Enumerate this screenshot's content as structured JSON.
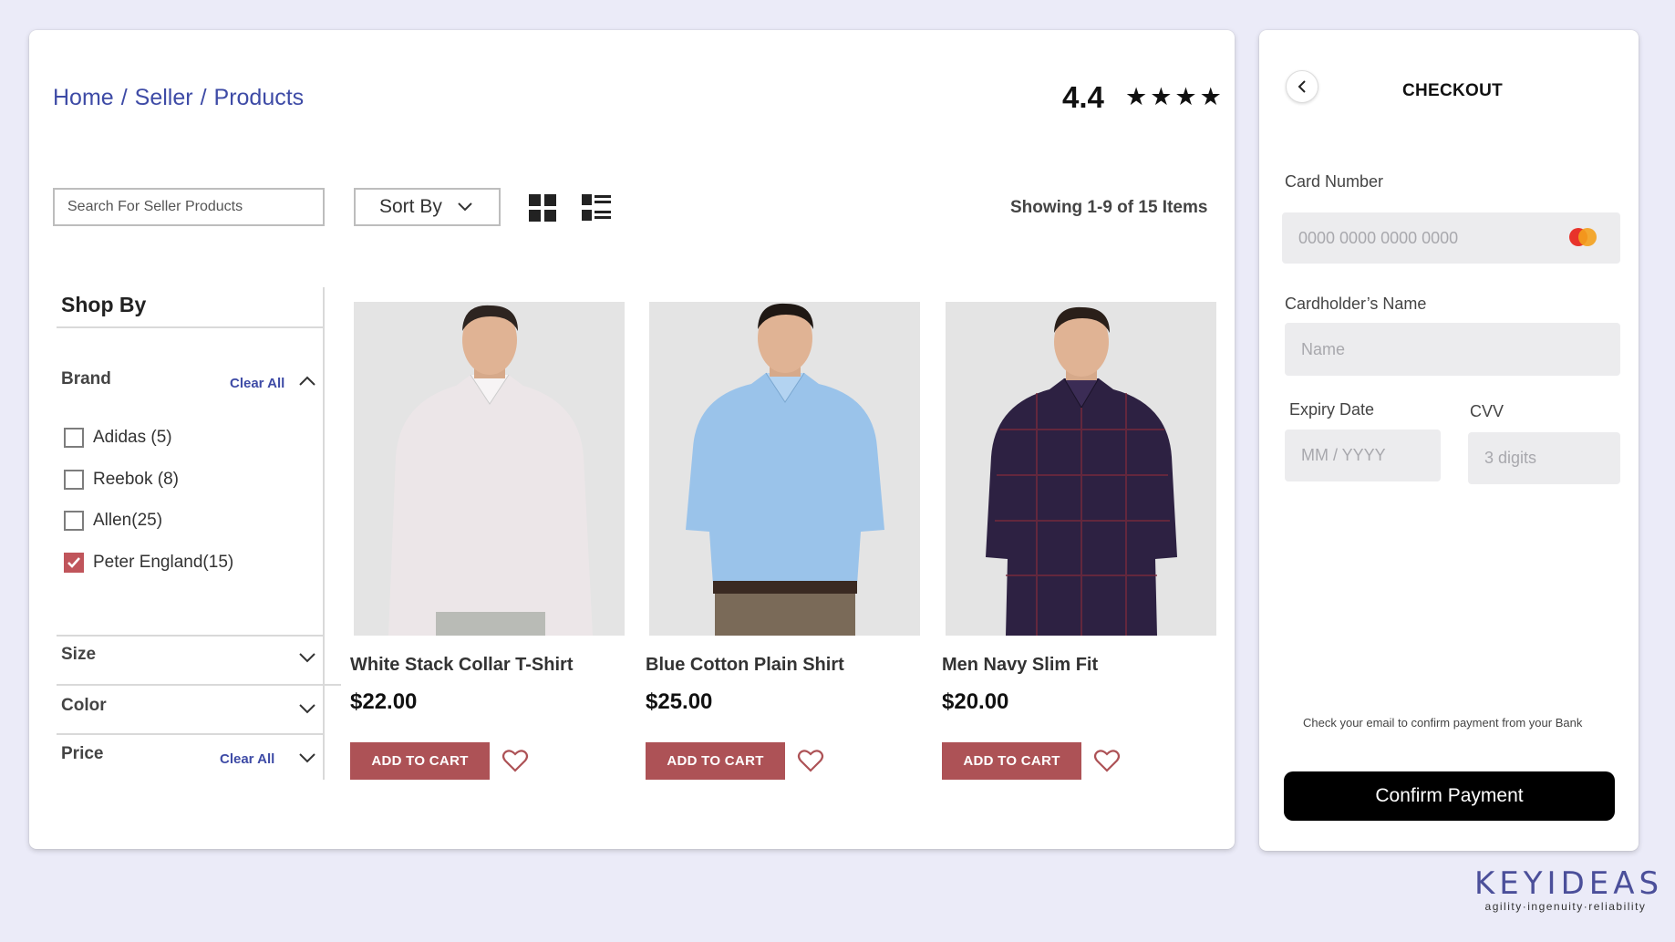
{
  "breadcrumb": {
    "items": [
      "Home",
      "Seller",
      "Products"
    ],
    "separator": "/"
  },
  "rating": {
    "value": "4.4",
    "stars": "★★★★"
  },
  "search": {
    "placeholder": "Search For Seller Products"
  },
  "sort": {
    "label": "Sort By"
  },
  "results": {
    "showing": "Showing 1-9 of 15 Items"
  },
  "sidebar": {
    "title": "Shop By",
    "brand": {
      "title": "Brand",
      "clear": "Clear All",
      "options": [
        {
          "label": "Adidas (5)",
          "checked": false
        },
        {
          "label": "Reebok (8)",
          "checked": false
        },
        {
          "label": "Allen(25)",
          "checked": false
        },
        {
          "label": "Peter England(15)",
          "checked": true
        }
      ]
    },
    "size": {
      "title": "Size"
    },
    "color": {
      "title": "Color"
    },
    "price": {
      "title": "Price",
      "clear": "Clear All"
    }
  },
  "products": [
    {
      "name": "White Stack Collar T-Shirt",
      "price": "$22.00",
      "cart_label": "ADD TO CART",
      "shirt_color": "#ece6e8"
    },
    {
      "name": "Blue Cotton Plain Shirt",
      "price": "$25.00",
      "cart_label": "ADD TO CART",
      "shirt_color": "#9ac3ea"
    },
    {
      "name": "Men Navy Slim Fit",
      "price": "$20.00",
      "cart_label": "ADD TO CART",
      "shirt_color": "#2d2142"
    }
  ],
  "checkout": {
    "title": "CHECKOUT",
    "card_number": {
      "label": "Card Number",
      "placeholder": "0000 0000 0000 0000"
    },
    "cardholder": {
      "label": "Cardholder’s Name",
      "placeholder": "Name"
    },
    "expiry": {
      "label": "Expiry Date",
      "placeholder": "MM / YYYY"
    },
    "cvv": {
      "label": "CVV",
      "placeholder": "3 digits"
    },
    "note": "Check your email to confirm payment from your Bank",
    "confirm_label": "Confirm Payment"
  },
  "logo": {
    "main": "KEYIDEAS",
    "tagline": "agility·ingenuity·reliability"
  },
  "colors": {
    "accent": "#3e4ba6",
    "cart_button": "#ad5256",
    "checkbox_checked": "#c0555b",
    "background": "#ebebf8"
  }
}
